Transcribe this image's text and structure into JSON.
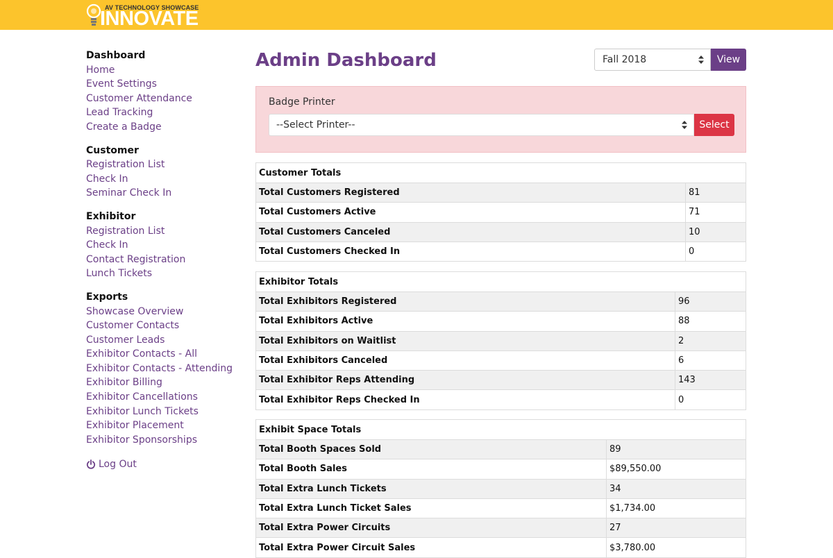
{
  "header": {
    "logo_tagline": "AV TECHNOLOGY SHOWCASE",
    "logo_wordmark": "INNOVATE",
    "bar_color": "#fcc42c"
  },
  "sidebar": {
    "groups": [
      {
        "heading": "Dashboard",
        "items": [
          "Home",
          "Event Settings",
          "Customer Attendance",
          "Lead Tracking",
          "Create a Badge"
        ]
      },
      {
        "heading": "Customer",
        "items": [
          "Registration List",
          "Check In",
          "Seminar Check In"
        ]
      },
      {
        "heading": "Exhibitor",
        "items": [
          "Registration List",
          "Check In",
          "Contact Registration",
          "Lunch Tickets"
        ]
      },
      {
        "heading": "Exports",
        "items": [
          "Showcase Overview",
          "Customer Contacts",
          "Customer Leads",
          "Exhibitor Contacts - All",
          "Exhibitor Contacts - Attending",
          "Exhibitor Billing",
          "Exhibitor Cancellations",
          "Exhibitor Lunch Tickets",
          "Exhibitor Placement",
          "Exhibitor Sponsorships"
        ]
      }
    ],
    "logout_label": "Log Out",
    "logout_icon": "power-icon"
  },
  "main": {
    "title": "Admin Dashboard",
    "term_select": {
      "value": "Fall 2018"
    },
    "view_label": "View",
    "badge_printer": {
      "label": "Badge Printer",
      "select_value": "--Select Printer--",
      "button_label": "Select"
    },
    "customer_totals": {
      "title": "Customer Totals",
      "rows": [
        {
          "label": "Total Customers Registered",
          "value": "81"
        },
        {
          "label": "Total Customers Active",
          "value": "71"
        },
        {
          "label": "Total Customers Canceled",
          "value": "10"
        },
        {
          "label": "Total Customers Checked In",
          "value": "0"
        }
      ]
    },
    "exhibitor_totals": {
      "title": "Exhibitor Totals",
      "rows": [
        {
          "label": "Total Exhibitors Registered",
          "value": "96"
        },
        {
          "label": "Total Exhibitors Active",
          "value": "88"
        },
        {
          "label": "Total Exhibitors on Waitlist",
          "value": "2"
        },
        {
          "label": "Total Exhibitors Canceled",
          "value": "6"
        },
        {
          "label": "Total Exhibitor Reps Attending",
          "value": "143"
        },
        {
          "label": "Total Exhibitor Reps Checked In",
          "value": "0"
        }
      ]
    },
    "exhibit_space_totals": {
      "title": "Exhibit Space Totals",
      "rows": [
        {
          "label": "Total Booth Spaces Sold",
          "value": "89"
        },
        {
          "label": "Total Booth Sales",
          "value": "$89,550.00"
        },
        {
          "label": "Total Extra Lunch Tickets",
          "value": "34"
        },
        {
          "label": "Total Extra Lunch Ticket Sales",
          "value": "$1,734.00"
        },
        {
          "label": "Total Extra Power Circuits",
          "value": "27"
        },
        {
          "label": "Total Extra Power Circuit Sales",
          "value": "$3,780.00"
        }
      ]
    }
  },
  "colors": {
    "brand_purple": "#6b3f87",
    "danger_red": "#dc3545",
    "alert_pink": "#f8d7da"
  }
}
